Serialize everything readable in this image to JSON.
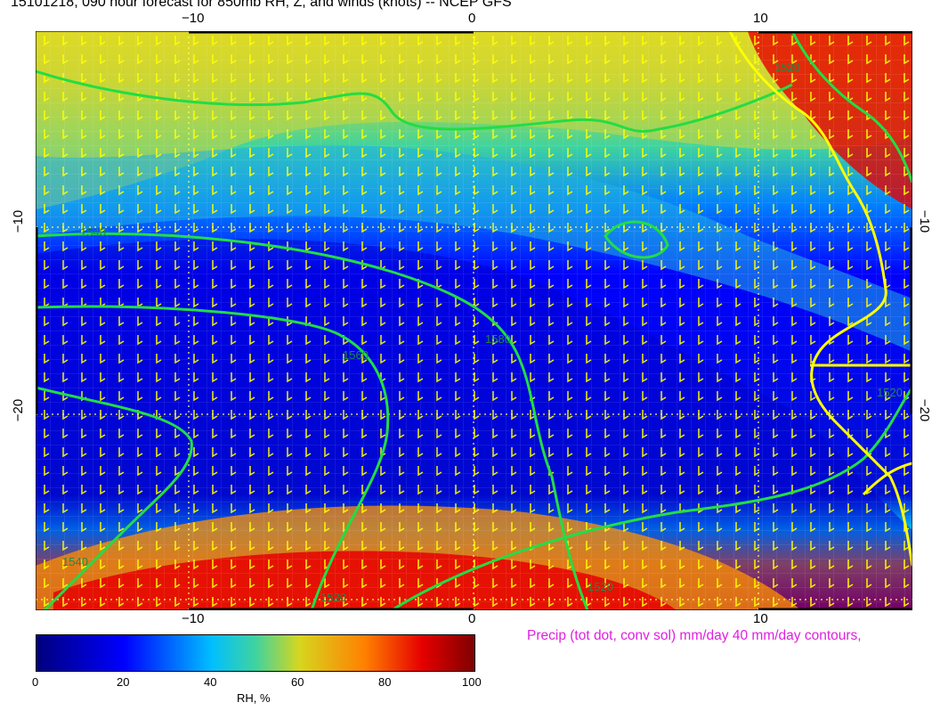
{
  "title": "15101218, 090 hour forecast for 850mb RH, Z, and winds (knots)  -- NCEP GFS",
  "axes": {
    "top_labels": [
      "−10",
      "0",
      "10"
    ],
    "bottom_labels": [
      "−10",
      "0",
      "10"
    ],
    "left_labels": [
      "−10",
      "−20"
    ],
    "right_labels": [
      "−10",
      "−20"
    ]
  },
  "contour_labels": [
    "1540",
    "1560",
    "1580",
    "1520",
    "1520",
    "1540",
    "1520",
    "1520"
  ],
  "precip_note": "Precip (tot dot, conv sol) mm/day 40 mm/day contours,",
  "colorbar": {
    "ticks": [
      "0",
      "20",
      "40",
      "60",
      "80",
      "100"
    ],
    "label": "RH, %",
    "colors": [
      "#00007f",
      "#0000ff",
      "#00bfff",
      "#3fd3a0",
      "#d6d61f",
      "#ff8000",
      "#e60000",
      "#7f0000"
    ]
  }
}
